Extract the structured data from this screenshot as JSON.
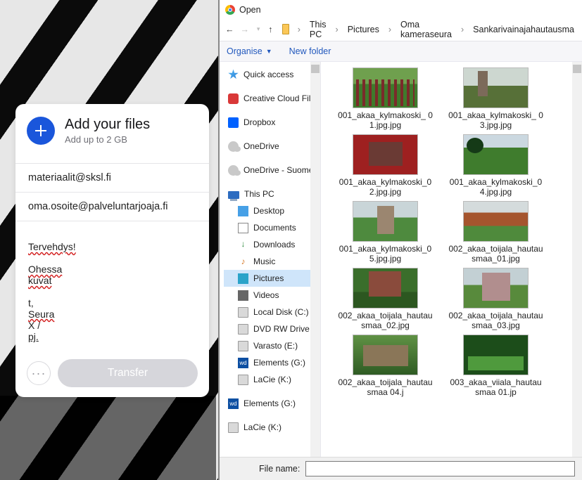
{
  "upload": {
    "title": "Add your files",
    "subtitle": "Add up to 2 GB",
    "to_field": "materiaalit@sksl.fi",
    "from_field": "oma.osoite@palveluntarjoaja.fi",
    "message_line1": "Tervehdys!",
    "message_line2a": "Ohessa",
    "message_line2b": "kuvat",
    "message_line3a": "t,",
    "message_line3b": "Seura",
    "message_line3c": "X /",
    "message_line3d": "pj.",
    "transfer_label": "Transfer",
    "more_label": "···"
  },
  "dialog": {
    "title": "Open",
    "crumb1": "This PC",
    "crumb2": "Pictures",
    "crumb3": "Oma kameraseura",
    "crumb4": "Sankarivainajahautausma",
    "organise": "Organise",
    "newfolder": "New folder",
    "filename_label": "File name:",
    "filename_value": ""
  },
  "nav": {
    "quick": "Quick access",
    "cc": "Creative Cloud Fil",
    "dropbox": "Dropbox",
    "onedrive": "OneDrive",
    "onedrive_s": "OneDrive - Suome",
    "thispc": "This PC",
    "desktop": "Desktop",
    "documents": "Documents",
    "downloads": "Downloads",
    "music": "Music",
    "pictures": "Pictures",
    "videos": "Videos",
    "localdisk": "Local Disk (C:)",
    "dvd": "DVD RW Drive (D",
    "varasto": "Varasto (E:)",
    "elements_g": "Elements (G:)",
    "lacie_k": "LaCie (K:)",
    "elements_g2": "Elements (G:)",
    "lacie_k2": "LaCie (K:)"
  },
  "files": [
    {
      "name": "001_akaa_kylmakoski_ 01.jpg.jpg",
      "style": "p-graves"
    },
    {
      "name": "001_akaa_kylmakoski_ 03.jpg.jpg",
      "style": "p-statue"
    },
    {
      "name": "001_akaa_kylmakoski_02.jpg.jpg",
      "style": "p-redleaf"
    },
    {
      "name": "001_akaa_kylmakoski_04.jpg.jpg",
      "style": "p-trees"
    },
    {
      "name": "001_akaa_kylmakoski_05.jpg.jpg",
      "style": "p-grave2"
    },
    {
      "name": "002_akaa_toijala_hautausmaa_01.jpg",
      "style": "p-beds"
    },
    {
      "name": "002_akaa_toijala_hautausmaa_02.jpg",
      "style": "p-stone"
    },
    {
      "name": "002_akaa_toijala_hautausmaa_03.jpg",
      "style": "p-mon"
    },
    {
      "name": "002_akaa_toijala_hautausmaa 04.j",
      "style": "p-slab"
    },
    {
      "name": "003_akaa_viiala_hautausmaa 01.jp",
      "style": "p-hedge"
    }
  ]
}
